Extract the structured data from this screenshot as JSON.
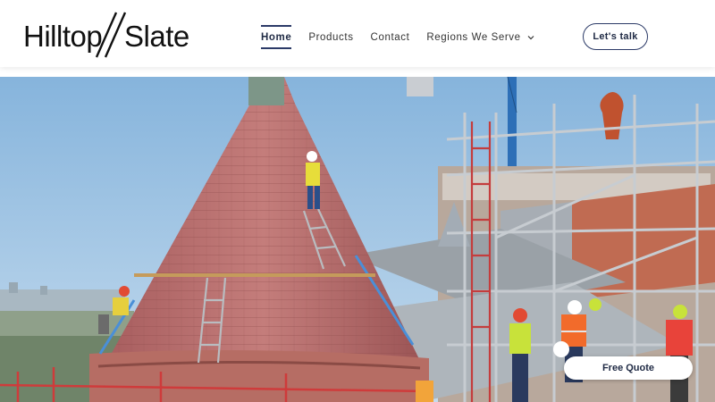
{
  "header": {
    "logo": {
      "part1": "Hilltop",
      "part2": "Slate"
    },
    "nav": [
      {
        "label": "Home",
        "active": true
      },
      {
        "label": "Products"
      },
      {
        "label": "Contact"
      },
      {
        "label": "Regions We Serve",
        "has_dropdown": true
      }
    ],
    "cta_label": "Let's talk"
  },
  "hero": {
    "image": "construction workers on scaffolding installing slate on a conical turret roof",
    "floating_button_label": "Free Quote"
  },
  "colors": {
    "brand_navy": "#2b3a67",
    "text_dark": "#1f2a44",
    "sky": "#9ec3e2",
    "slate_red": "#b5696a"
  }
}
